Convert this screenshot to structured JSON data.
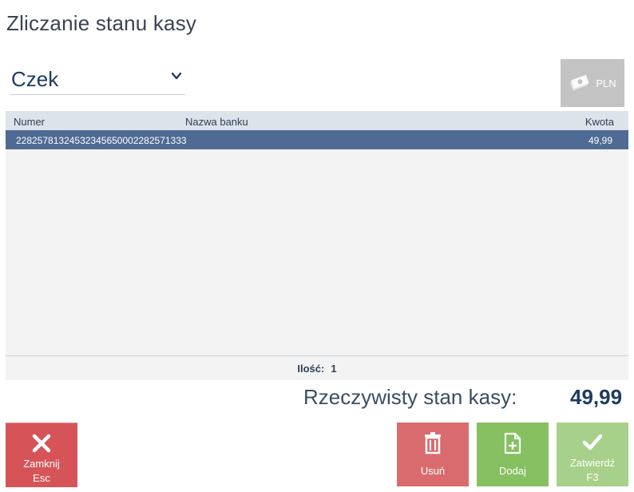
{
  "title": "Zliczanie stanu kasy",
  "type_select": {
    "value": "Czek",
    "icon": "chevron-down-icon"
  },
  "currency_button": {
    "label": "PLN",
    "icon": "banknotes-icon"
  },
  "grid": {
    "columns": {
      "number": "Numer",
      "bank": "Nazwa banku",
      "amount": "Kwota"
    },
    "rows": [
      {
        "number": "22825781324532345650002282571333",
        "bank": "",
        "amount": "49,99"
      }
    ],
    "footer_label": "Ilość:",
    "footer_count": "1"
  },
  "summary": {
    "label": "Rzeczywisty stan kasy:",
    "value": "49,99"
  },
  "buttons": {
    "close": {
      "line1": "Zamknij",
      "line2": "Esc",
      "icon": "close-icon"
    },
    "delete": {
      "label": "Usuń",
      "icon": "trash-icon"
    },
    "add": {
      "label": "Dodaj",
      "icon": "add-document-icon"
    },
    "confirm": {
      "line1": "Zatwierdź",
      "line2": "F3",
      "icon": "checkmark-icon"
    }
  },
  "colors": {
    "accent_dark": "#1f3b63",
    "row_selected": "#4f6a93",
    "close": "#d65458",
    "delete": "#d96b6e",
    "add": "#86c060",
    "confirm": "#a7d08a",
    "currency_disabled": "#c3c3c3"
  }
}
